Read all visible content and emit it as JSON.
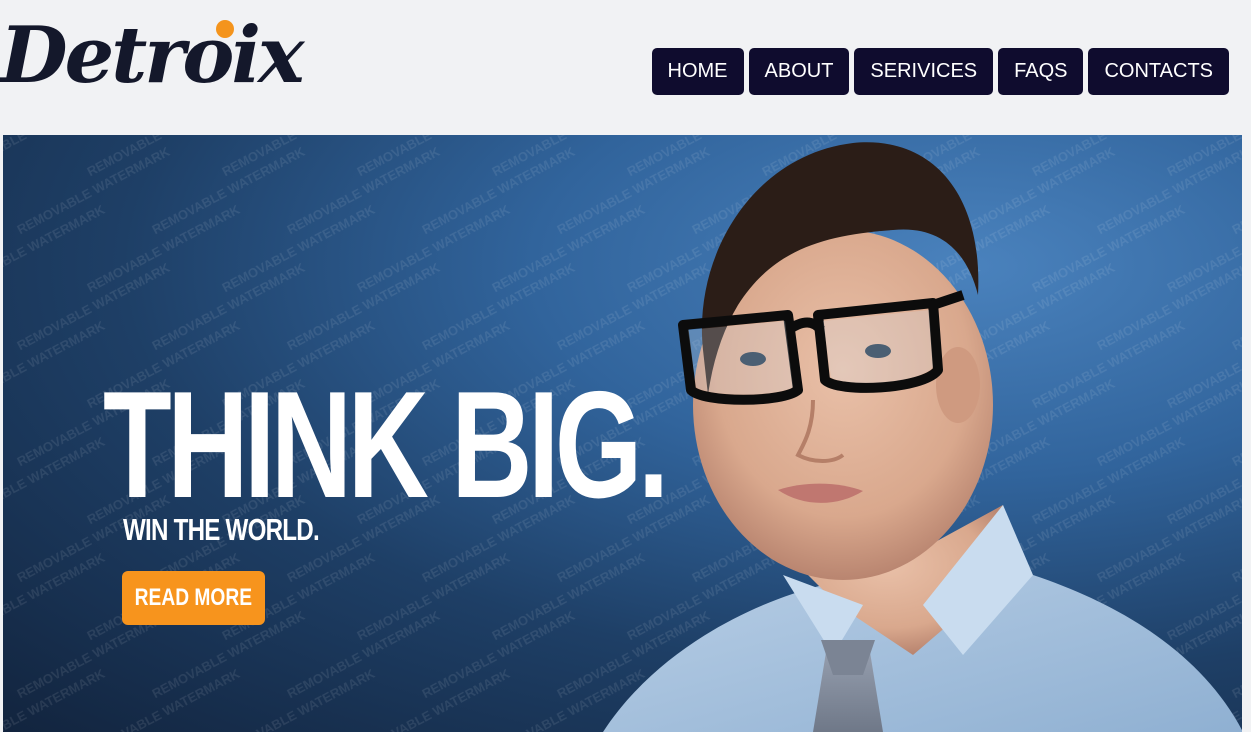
{
  "header": {
    "logo_text": "Detroix",
    "nav": [
      {
        "label": "HOME"
      },
      {
        "label": "ABOUT"
      },
      {
        "label": "SERIVICES"
      },
      {
        "label": "FAQS"
      },
      {
        "label": "CONTACTS"
      }
    ]
  },
  "banner": {
    "headline": "THINK BIG.",
    "subline": "WIN THE WORLD.",
    "cta_label": "READ MORE",
    "watermark_text": "REMOVABLE WATERMARK"
  },
  "colors": {
    "page_background": "#f1f2f4",
    "logo_text": "#14182b",
    "logo_dot": "#f4941c",
    "nav_background": "#0f0c2e",
    "banner_background": "#2a5a8f",
    "cta_background": "#f7941d"
  }
}
